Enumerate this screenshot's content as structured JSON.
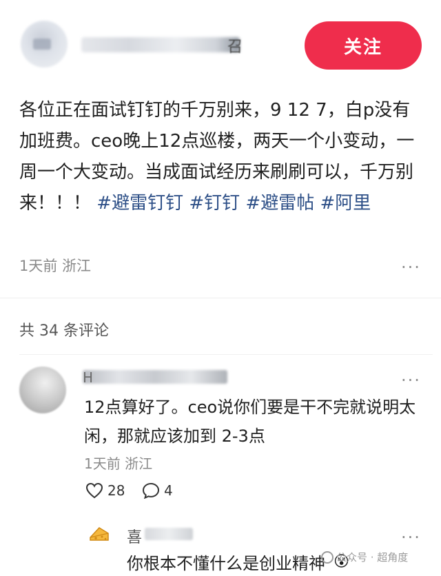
{
  "header": {
    "username_partial": "召",
    "follow_label": "关注"
  },
  "post": {
    "text": "各位正在面试钉钉的千万别来，9 12 7，白p没有加班费。ceo晚上12点巡楼，两天一个小变动，一周一个大变动。当成面试经历来刷刷可以，千万别来！！！",
    "hashtags": [
      "#避雷钉钉",
      "#钉钉",
      "#避雷帖",
      "#阿里"
    ],
    "meta": "1天前 浙江",
    "more_icon": "···"
  },
  "comments": {
    "count_label": "共 34 条评论",
    "items": [
      {
        "name_partial": "H",
        "text": "12点算好了。ceo说你们要是干不完就说明太闲，那就应该加到 2-3点",
        "meta": "1天前 浙江",
        "likes": "28",
        "replies": "4"
      }
    ],
    "reply": {
      "name_partial": "喜",
      "text": "你根本不懂什么是创业精神",
      "emoji": "😵"
    }
  },
  "watermark": "公众号 · 超角度",
  "icons": {
    "more": "more-icon",
    "like": "heart-icon",
    "reply": "comment-icon",
    "cheese": "cheese-icon"
  },
  "colors": {
    "accent": "#ef2d4c",
    "hashtag": "#2d4f87",
    "meta": "#8a8a8a"
  }
}
